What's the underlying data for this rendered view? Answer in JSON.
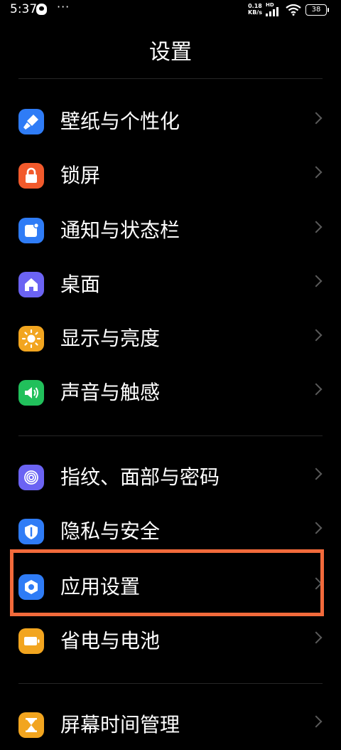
{
  "status": {
    "time": "5:37",
    "more": "···",
    "speed_value": "0.18",
    "speed_unit": "KB/s",
    "network": "HD",
    "battery": "38"
  },
  "title": "设置",
  "groups": [
    {
      "items": [
        {
          "label": "壁纸与个性化",
          "icon": "brush-icon",
          "color": "#2f7cf6"
        },
        {
          "label": "锁屏",
          "icon": "lock-icon",
          "color": "#f25a2c"
        },
        {
          "label": "通知与状态栏",
          "icon": "notification-icon",
          "color": "#2f7cf6"
        },
        {
          "label": "桌面",
          "icon": "home-icon",
          "color": "#6b63f3"
        },
        {
          "label": "显示与亮度",
          "icon": "sun-icon",
          "color": "#f2a51f"
        },
        {
          "label": "声音与触感",
          "icon": "speaker-icon",
          "color": "#21c05b"
        }
      ]
    },
    {
      "items": [
        {
          "label": "指纹、面部与密码",
          "icon": "fingerprint-icon",
          "color": "#6b63f3"
        },
        {
          "label": "隐私与安全",
          "icon": "privacy-shield-icon",
          "color": "#2f7cf6"
        },
        {
          "label": "应用设置",
          "icon": "app-settings-icon",
          "color": "#2f7cf6"
        },
        {
          "label": "省电与电池",
          "icon": "battery-icon",
          "color": "#f2a51f"
        }
      ]
    },
    {
      "items": [
        {
          "label": "屏幕时间管理",
          "icon": "hourglass-icon",
          "color": "#f2a51f"
        }
      ]
    }
  ],
  "highlight_color": "#f26a3b"
}
